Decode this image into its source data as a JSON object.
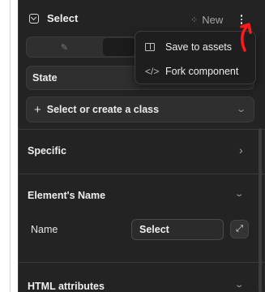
{
  "header": {
    "icon": "select-element-icon",
    "title": "Select",
    "new_icon": "move-dots-icon",
    "new_label": "New",
    "more_icon": "vertical-ellipsis-icon"
  },
  "toggle": {
    "left_icon": "pencil-icon"
  },
  "state": {
    "label": "State"
  },
  "class_selector": {
    "plus_icon": "plus-icon",
    "label": "Select or create a class",
    "chevron_icon": "chevron-down-icon"
  },
  "sections": {
    "specific": {
      "title": "Specific",
      "chevron_icon": "chevron-right-icon"
    },
    "element_name": {
      "title": "Element's Name",
      "chevron_icon": "chevron-down-icon",
      "name_label": "Name",
      "name_value": "Select",
      "expand_icon": "expand-arrows-icon"
    },
    "html_attributes": {
      "title": "HTML attributes",
      "chevron_icon": "chevron-down-icon"
    }
  },
  "menu": {
    "items": [
      {
        "icon": "book-icon",
        "label": "Save to assets"
      },
      {
        "icon": "code-icon",
        "label": "Fork component"
      }
    ]
  },
  "colors": {
    "panel_bg": "#232323",
    "menu_bg": "#1e1e1e",
    "annotation_red": "#ff1a1a"
  }
}
